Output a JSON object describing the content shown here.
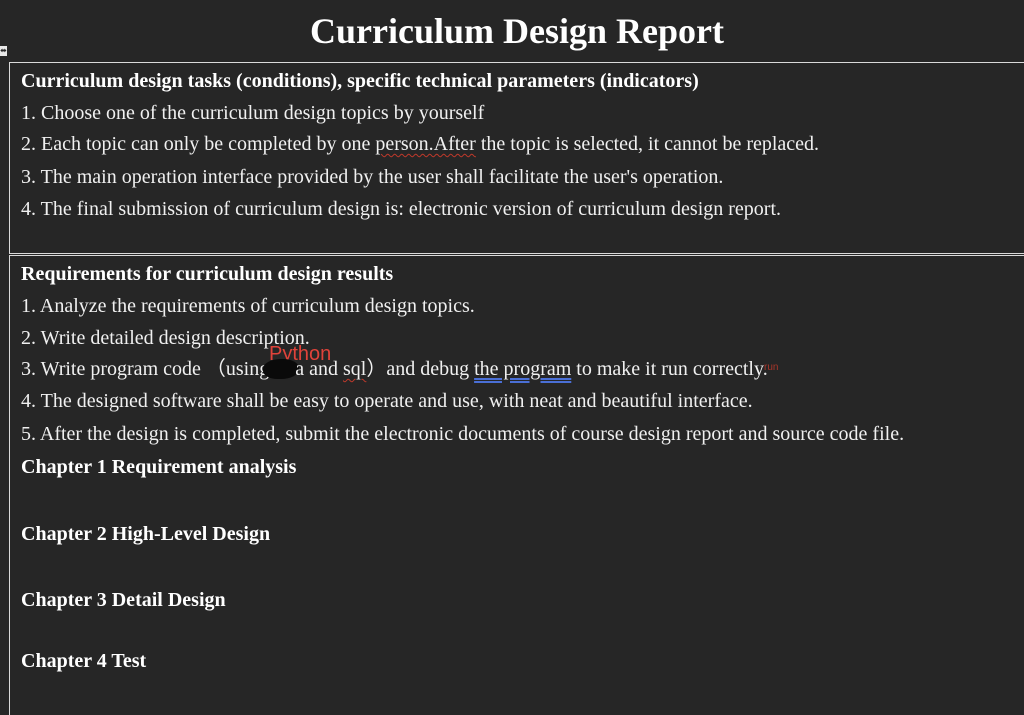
{
  "title": "Curriculum Design Report",
  "table_marker_icon": "table-move-handle",
  "section1": {
    "heading": "Curriculum design tasks (conditions), specific technical parameters (indicators)",
    "items": [
      "1. Choose one of the curriculum design topics by yourself",
      {
        "before": "2. Each topic can only be completed by one ",
        "squiggle": "person.After",
        "after": " the topic is selected, it cannot be replaced."
      },
      "3. The main operation interface provided by the user shall facilitate the user's operation.",
      "4. The final submission of curriculum design is: electronic version of curriculum design report."
    ]
  },
  "section2": {
    "heading": "Requirements for curriculum design results",
    "item1": "1. Analyze the requirements of curriculum design topics.",
    "item2": "2. Write detailed design description.",
    "item3": {
      "part_a": "3. Write program code  （using",
      "part_b": "a and ",
      "part_c": "sql",
      "part_d": "）and debug ",
      "part_e": "the    program",
      "part_f": " to make it run ",
      "part_g": "correctly."
    },
    "python_annotation": "Python",
    "tiny_annotation": "run",
    "item4": "4. The designed software shall be easy to operate and use, with neat and beautiful interface.",
    "item5": "5. After the design is completed, submit the electronic documents of course design report and source code file.",
    "chapters": [
      "Chapter 1 Requirement analysis",
      "Chapter 2 High-Level Design",
      "Chapter 3 Detail Design",
      "Chapter 4 Test"
    ]
  }
}
